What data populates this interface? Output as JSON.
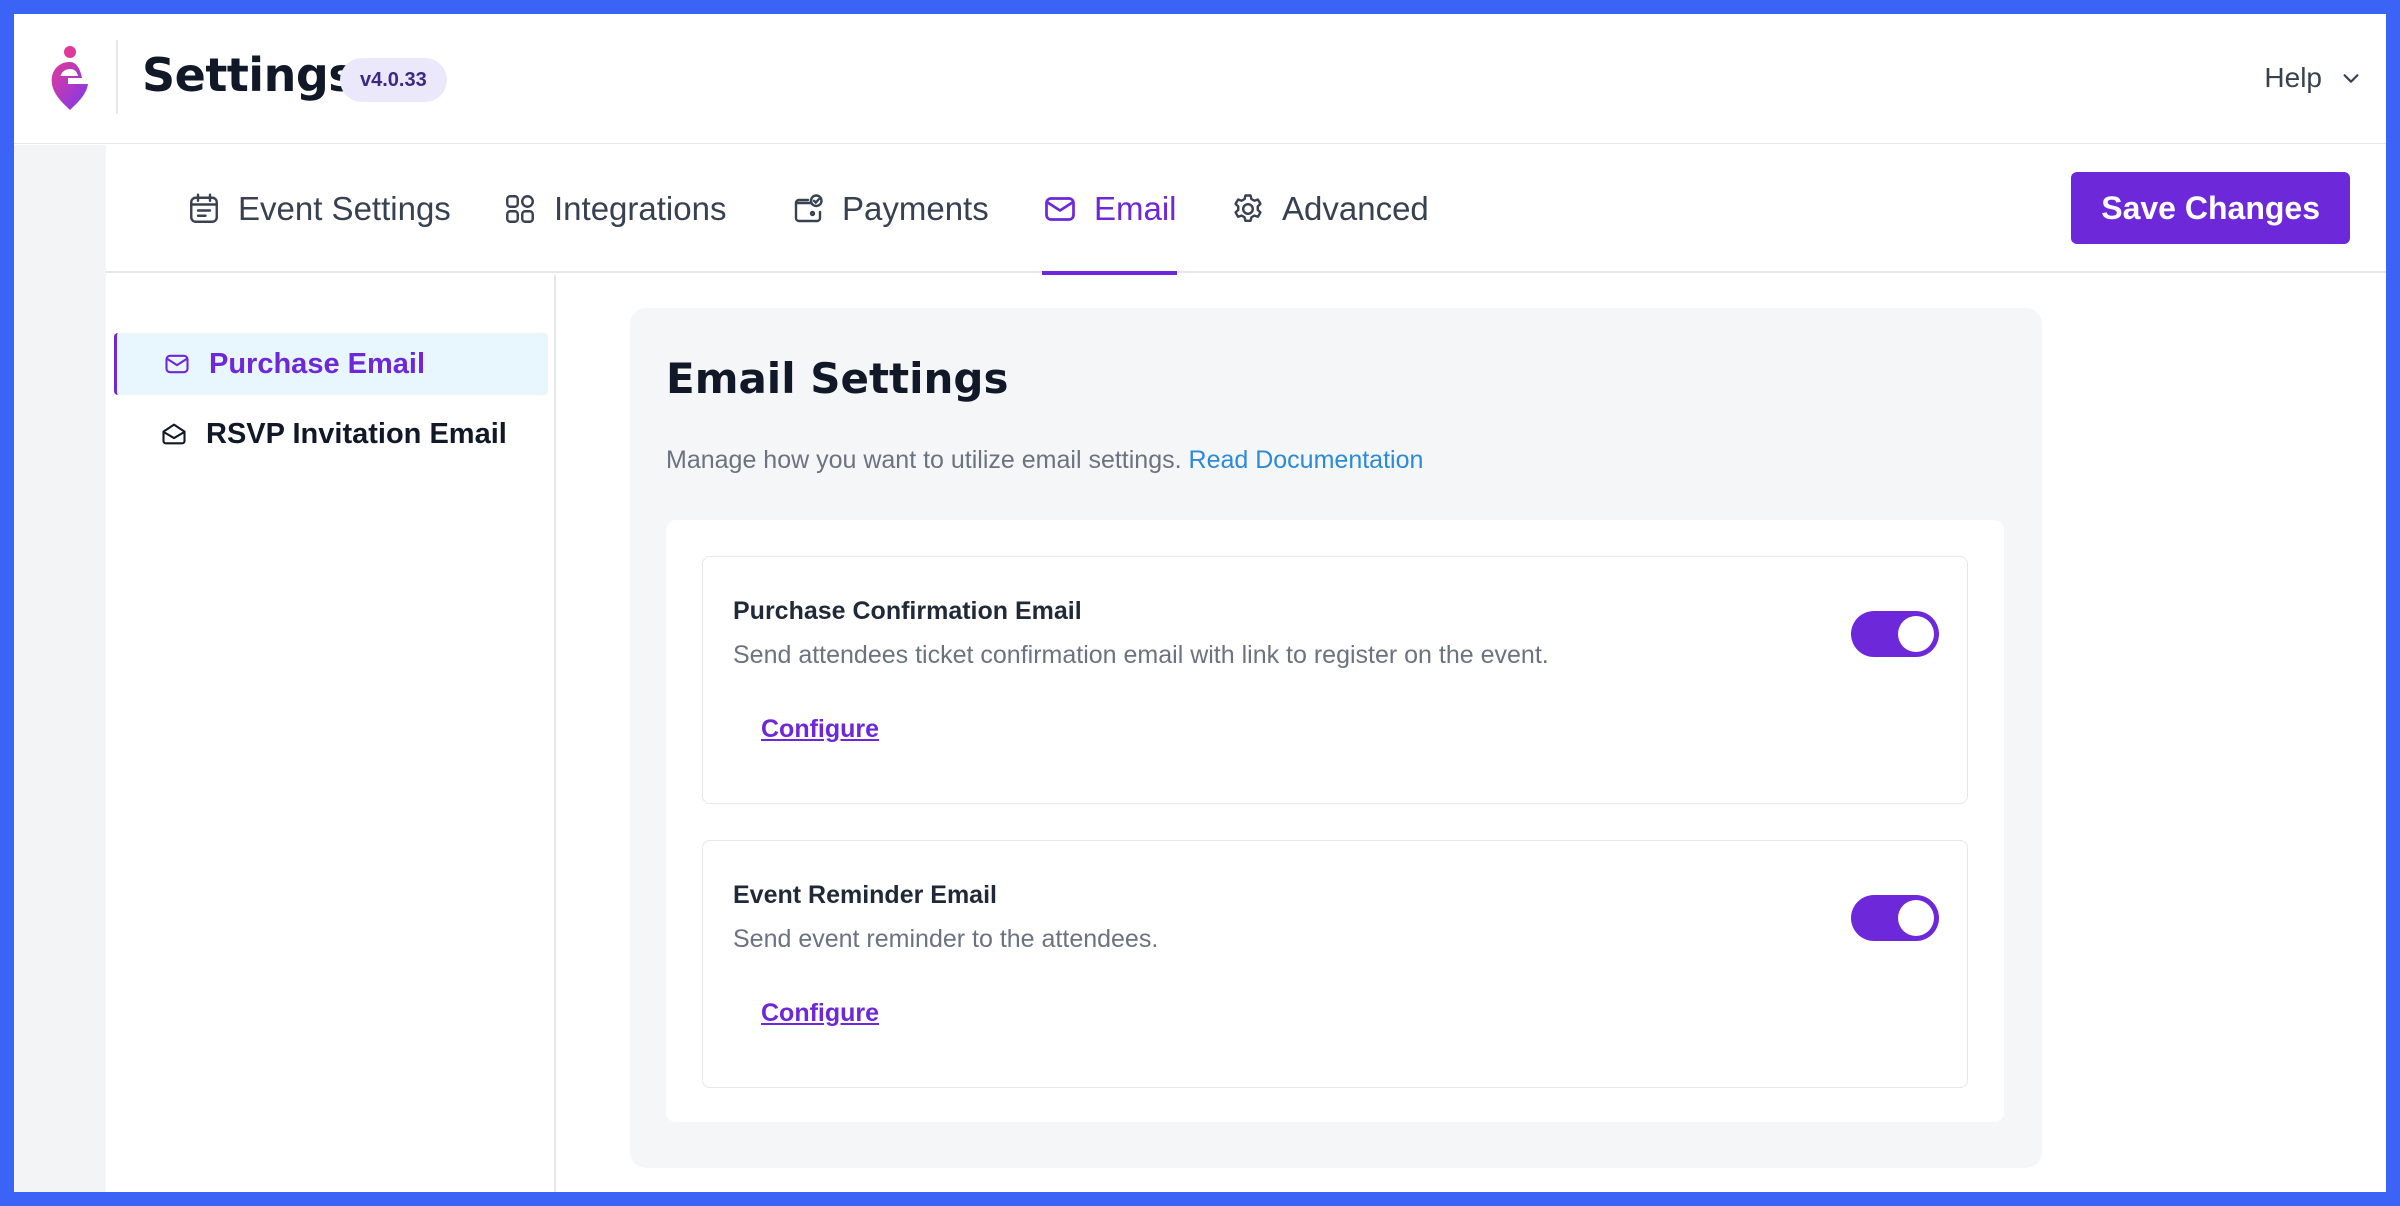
{
  "app": {
    "title": "Settings",
    "version": "v4.0.33",
    "help_label": "Help"
  },
  "tabs": [
    {
      "label": "Event Settings",
      "icon": "calendar-list-icon"
    },
    {
      "label": "Integrations",
      "icon": "grid-icon"
    },
    {
      "label": "Payments",
      "icon": "wallet-icon"
    },
    {
      "label": "Email",
      "icon": "envelope-icon",
      "active": true
    },
    {
      "label": "Advanced",
      "icon": "gear-icon"
    }
  ],
  "save_button": "Save Changes",
  "sidebar": {
    "items": [
      {
        "label": "Purchase Email",
        "icon": "envelope-icon",
        "active": true
      },
      {
        "label": "RSVP Invitation Email",
        "icon": "envelope-open-icon"
      }
    ]
  },
  "panel": {
    "title": "Email Settings",
    "description": "Manage how you want to utilize email settings.",
    "doc_link": "Read Documentation"
  },
  "cards": [
    {
      "title": "Purchase Confirmation Email",
      "description": "Send attendees ticket confirmation email with link to register on the event.",
      "configure": "Configure",
      "enabled": true
    },
    {
      "title": "Event Reminder Email",
      "description": "Send event reminder to the attendees.",
      "configure": "Configure",
      "enabled": true
    }
  ],
  "colors": {
    "accent": "#6d28d9",
    "border_frame": "#3b63f5",
    "link": "#2b8ad9"
  }
}
